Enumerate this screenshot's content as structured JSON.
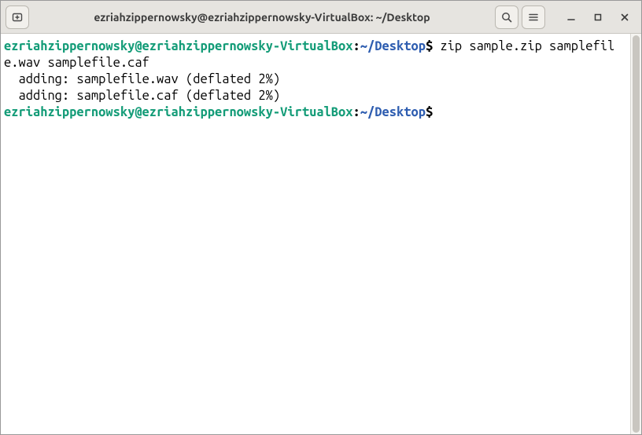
{
  "window": {
    "title": "ezriahzippernowsky@ezriahzippernowsky-VirtualBox: ~/Desktop"
  },
  "prompt": {
    "user_host": "ezriahzippernowsky@ezriahzippernowsky-VirtualBox",
    "colon": ":",
    "path": "~/Desktop",
    "dollar": "$"
  },
  "lines": {
    "cmd1": " zip sample.zip samplefile.wav samplefile.caf",
    "out1": "  adding: samplefile.wav (deflated 2%)",
    "out2": "  adding: samplefile.caf (deflated 2%)",
    "cmd2_trail": " "
  }
}
